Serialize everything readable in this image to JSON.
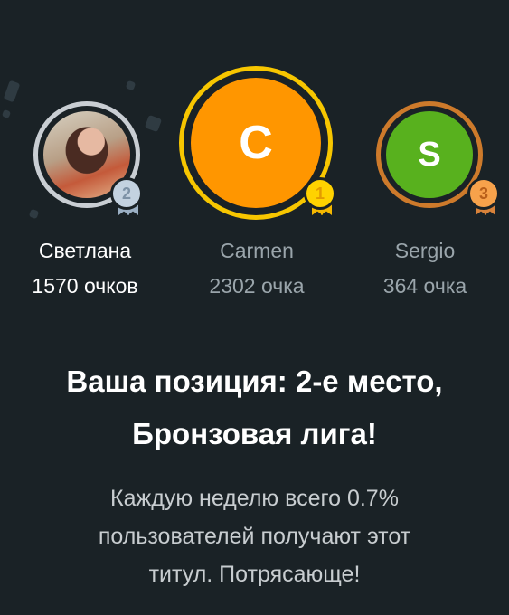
{
  "leaderboard": [
    {
      "rank": "2",
      "name": "Светлана",
      "score": "1570 очков",
      "initial": "",
      "medal": "silver",
      "avatar": "photo"
    },
    {
      "rank": "1",
      "name": "Carmen",
      "score": "2302 очка",
      "initial": "C",
      "medal": "gold",
      "color": "#ff9600"
    },
    {
      "rank": "3",
      "name": "Sergio",
      "score": "364 очка",
      "initial": "S",
      "medal": "bronze",
      "color": "#58b11e"
    }
  ],
  "result": {
    "headline_line1": "Ваша позиция: 2-е место,",
    "headline_line2": "Бронзовая лига!",
    "body_line1": "Каждую неделю всего 0.7%",
    "body_line2": "пользователей получают этот",
    "body_line3": "титул. Потрясающе!"
  },
  "colors": {
    "background": "#1a2226",
    "gold": "#f7c600",
    "silver": "#c9ced3",
    "bronze": "#cd7a2b"
  }
}
